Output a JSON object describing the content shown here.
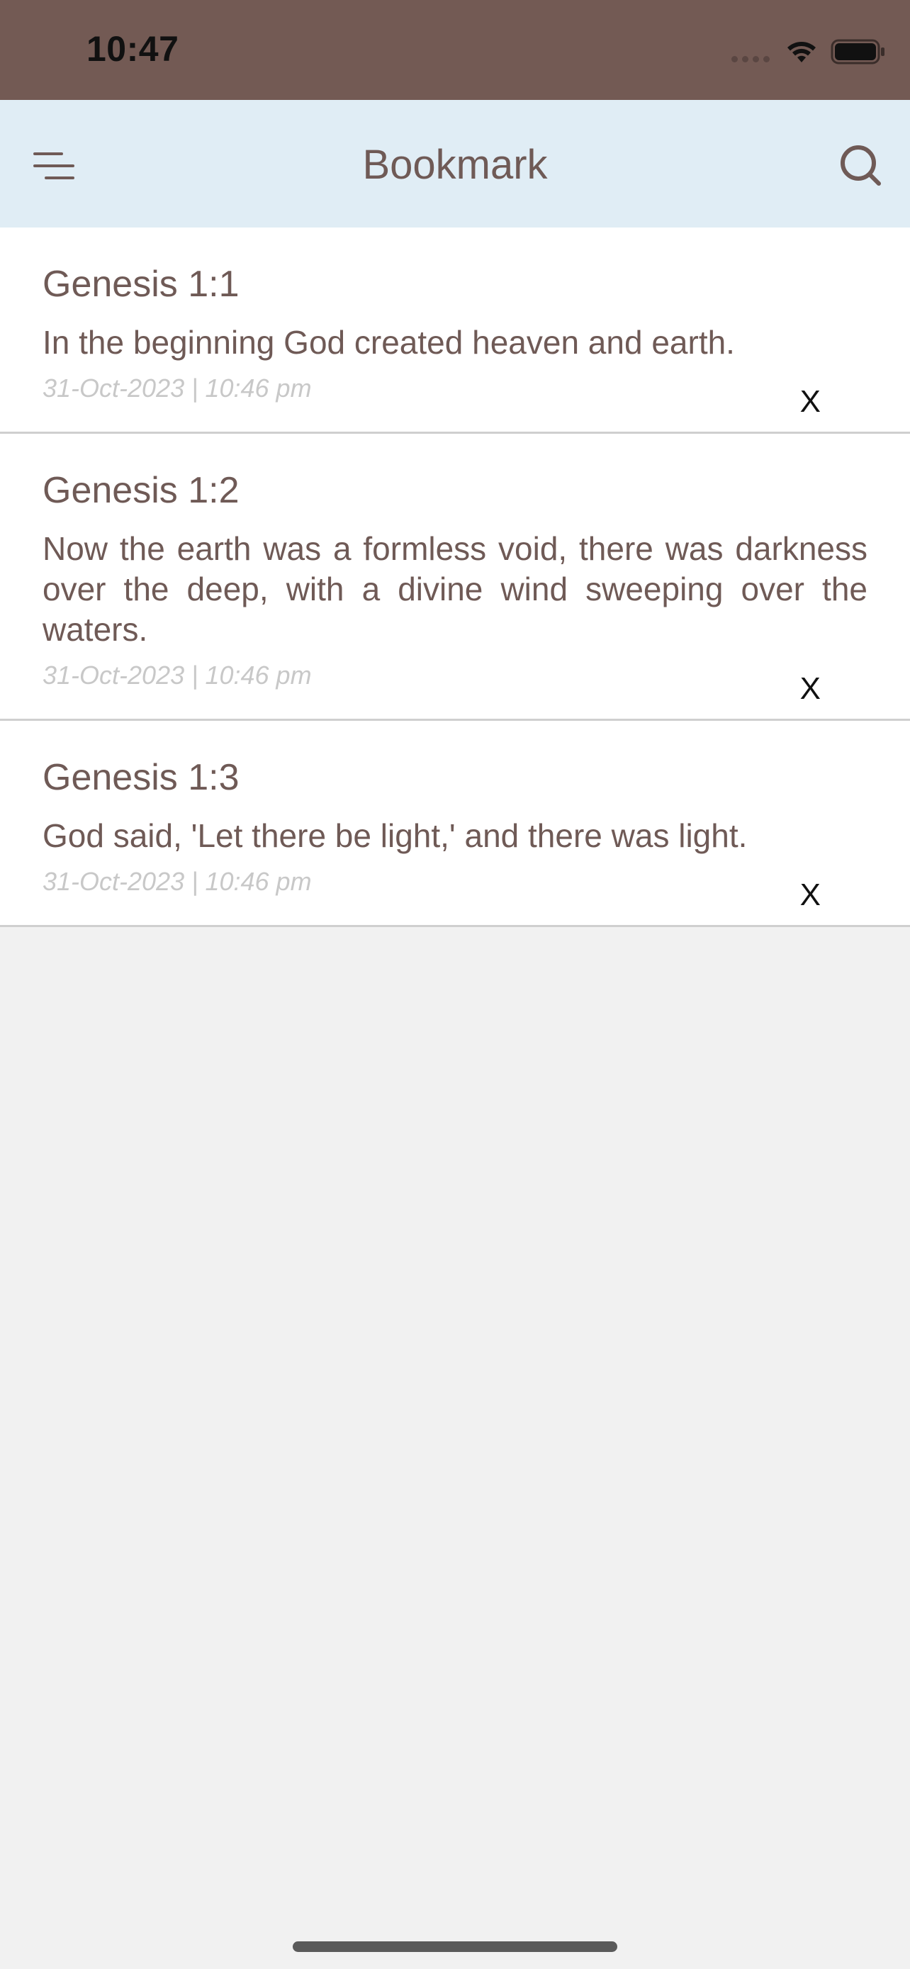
{
  "status_bar": {
    "time": "10:47",
    "icons": [
      "cellular-icon",
      "wifi-icon",
      "battery-icon"
    ]
  },
  "nav": {
    "title": "Bookmark",
    "menu_icon": "menu-icon",
    "search_icon": "search-icon"
  },
  "bookmarks": [
    {
      "ref": "Genesis 1:1",
      "text": "In the beginning God created heaven and earth.",
      "date": "31-Oct-2023 | 10:46 pm",
      "delete_label": "X"
    },
    {
      "ref": "Genesis 1:2",
      "text": "Now the earth was a formless void, there was darkness over the deep, with a divine wind sweeping over the waters.",
      "date": "31-Oct-2023 | 10:46 pm",
      "delete_label": "X"
    },
    {
      "ref": "Genesis 1:3",
      "text": "God said, 'Let there be light,' and there was light.",
      "date": "31-Oct-2023 | 10:46 pm",
      "delete_label": "X"
    }
  ],
  "colors": {
    "status_bar": "#735a54",
    "nav_bar": "#e0edf5",
    "text_brown": "#6f5a56",
    "date_gray": "#c8c8c8",
    "background": "#f1f1f1"
  }
}
